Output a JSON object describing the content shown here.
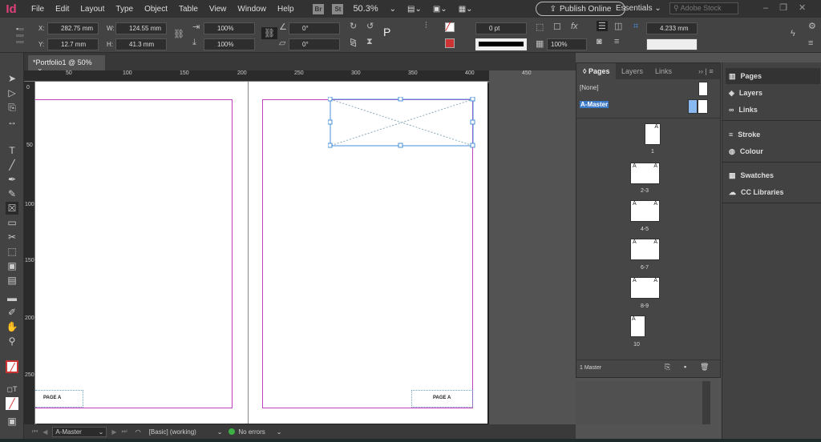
{
  "menubar": {
    "app_logo": "Id",
    "items": [
      "File",
      "Edit",
      "Layout",
      "Type",
      "Object",
      "Table",
      "View",
      "Window",
      "Help"
    ],
    "bridge": "Br",
    "stock": "St",
    "zoom": "50.3%",
    "publish": "Publish Online",
    "workspace": "Essentials",
    "search_placeholder": "Adobe Stock"
  },
  "control": {
    "x": "282.75 mm",
    "y": "12.7 mm",
    "w": "124.55 mm",
    "h": "41.3 mm",
    "x_label": "X:",
    "y_label": "Y:",
    "w_label": "W:",
    "h_label": "H:",
    "scale_x": "100%",
    "scale_y": "100%",
    "rotate": "0°",
    "shear": "0°",
    "stroke_weight": "0 pt",
    "opacity": "100%",
    "gap": "4.233 mm"
  },
  "tab": {
    "title": "*Portfolio1 @ 50%",
    "close": "×"
  },
  "ruler": {
    "h": [
      "50",
      "100",
      "150",
      "200",
      "250",
      "300",
      "350",
      "400",
      "450"
    ],
    "v": [
      "0",
      "50",
      "100",
      "150",
      "200",
      "250"
    ]
  },
  "document": {
    "left_footer": "PAGE A",
    "right_footer": "PAGE A"
  },
  "pages_panel": {
    "tabs": [
      "Pages",
      "Layers",
      "Links"
    ],
    "none": "[None]",
    "master": "A-Master",
    "pages": [
      "1",
      "2-3",
      "4-5",
      "6-7",
      "8-9",
      "10"
    ],
    "footer": "1 Master",
    "master_letter": "A"
  },
  "dock": {
    "items": [
      "Pages",
      "Layers",
      "Links",
      "Stroke",
      "Colour",
      "Swatches",
      "CC Libraries"
    ]
  },
  "status": {
    "page": "A-Master",
    "preflight_profile": "[Basic] (working)",
    "errors": "No errors"
  },
  "colors": {
    "accent": "#4a90d9",
    "margin": "#c040c0",
    "ok": "#3cb043"
  }
}
